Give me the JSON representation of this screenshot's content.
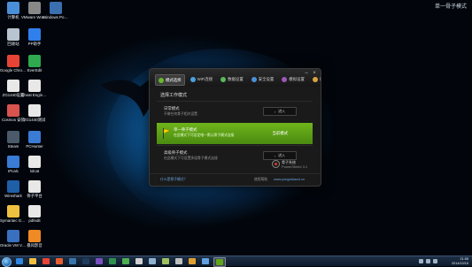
{
  "desktop": {
    "top_right_text": "单一骨子模式",
    "icons": [
      {
        "label": "计算机",
        "icon": "computer-icon",
        "color": "#4a90d9"
      },
      {
        "label": "VMware Workstation",
        "icon": "vmware-icon",
        "color": "#888888"
      },
      {
        "label": "Windows PowerShell",
        "icon": "powershell-icon",
        "color": "#3a6fb0"
      },
      {
        "label": "回收站",
        "icon": "recycle-bin-icon",
        "color": "#b8c4d0"
      },
      {
        "label": "PP助手",
        "icon": "pp-assistant-icon",
        "color": "#2f80ed"
      },
      {
        "label": "Google Chrome",
        "icon": "chrome-icon",
        "color": "#e84335"
      },
      {
        "label": "EverEdit",
        "icon": "everedit-icon",
        "color": "#2fa84f"
      },
      {
        "label": "ZG1440设置",
        "icon": "document-icon",
        "color": "#e8e8e8"
      },
      {
        "label": "Cheat Engine 6.3",
        "icon": "document-icon",
        "color": "#e8e8e8"
      },
      {
        "label": "Cosmos 安装",
        "icon": "cosmos-icon",
        "color": "#d9534f"
      },
      {
        "label": "ZG1440测试",
        "icon": "document-icon",
        "color": "#e8e8e8"
      },
      {
        "label": "Steam",
        "icon": "steam-icon",
        "color": "#4a5a6a"
      },
      {
        "label": "PCHunter",
        "icon": "pchunter-icon",
        "color": "#3a7bd5"
      },
      {
        "label": "IPcalc",
        "icon": "ipcalc-icon",
        "color": "#3a7bd5"
      },
      {
        "label": "lolcat",
        "icon": "document-icon",
        "color": "#e8e8e8"
      },
      {
        "label": "Wireshark",
        "icon": "wireshark-icon",
        "color": "#1f5fa8"
      },
      {
        "label": "骨子平台",
        "icon": "document-icon",
        "color": "#e8e8e8"
      },
      {
        "label": "Symantec Ghost",
        "icon": "ghost-icon",
        "color": "#f0c040"
      },
      {
        "label": "pdfedit",
        "icon": "document-icon",
        "color": "#e8e8e8"
      },
      {
        "label": "Oracle VM VirtualBox",
        "icon": "virtualbox-icon",
        "color": "#3a70c0"
      },
      {
        "label": "暴风影音",
        "icon": "media-player-icon",
        "color": "#f08a24"
      }
    ]
  },
  "window": {
    "tabs": [
      {
        "label": "模式选择",
        "icon": "mode-icon",
        "color": "#6ab82a",
        "active": true
      },
      {
        "label": "WiFi连接",
        "icon": "wifi-icon",
        "color": "#4aa0e0",
        "active": false
      },
      {
        "label": "数据设置",
        "icon": "data-icon",
        "color": "#5cb85c",
        "active": false
      },
      {
        "label": "安全设置",
        "icon": "security-icon",
        "color": "#4a90d9",
        "active": false
      },
      {
        "label": "模拟设置",
        "icon": "simulate-icon",
        "color": "#9b59b6",
        "active": false
      },
      {
        "label": "帮助",
        "icon": "help-icon",
        "color": "#d9a441",
        "active": false
      }
    ],
    "section_title": "选择工作模式",
    "modes": [
      {
        "title": "日常模式",
        "desc": "不做任何骨子相关设置",
        "button": "进入",
        "active": false
      },
      {
        "title": "单一骨子模式",
        "desc": "在此模式下可设定唯一默认骨子模式连接",
        "status": "当前模式",
        "active": true
      },
      {
        "title": "高级骨子模式",
        "desc": "在此模式下可设置多组骨子模式连接",
        "button": "进入",
        "active": false
      }
    ],
    "brand": {
      "line1": "骨子系统",
      "line2": "PowerShield 3.1"
    },
    "footer": {
      "left": "什么是骨子模式？",
      "middle": "使用帮助",
      "right": "www.yongzidianzi.cn"
    },
    "accent_color": "#5fa517"
  },
  "taskbar": {
    "apps": [
      {
        "icon": "ie-icon",
        "color": "#2e86de"
      },
      {
        "icon": "explorer-icon",
        "color": "#f0c040"
      },
      {
        "icon": "chrome-icon",
        "color": "#e84335"
      },
      {
        "icon": "media-icon",
        "color": "#e85d2e"
      },
      {
        "icon": "python-icon",
        "color": "#3776ab"
      },
      {
        "icon": "terminal-icon",
        "color": "#1f3b5c"
      },
      {
        "icon": "vs-icon",
        "color": "#7a4fbf"
      },
      {
        "icon": "excel-icon",
        "color": "#2f8f4f"
      },
      {
        "icon": "wechat-icon",
        "color": "#4caf50"
      },
      {
        "icon": "app-icon",
        "color": "#d0d0d0"
      },
      {
        "icon": "app-icon",
        "color": "#8fb0d0"
      },
      {
        "icon": "app-icon",
        "color": "#a0c060"
      },
      {
        "icon": "app-icon",
        "color": "#c0c0c0"
      },
      {
        "icon": "app-icon",
        "color": "#e0a030"
      },
      {
        "icon": "app-icon",
        "color": "#60a0e0"
      },
      {
        "icon": "shield-app-icon",
        "color": "#5fa517"
      }
    ],
    "clock_time": "21:55",
    "clock_date": "2014/10/15"
  }
}
